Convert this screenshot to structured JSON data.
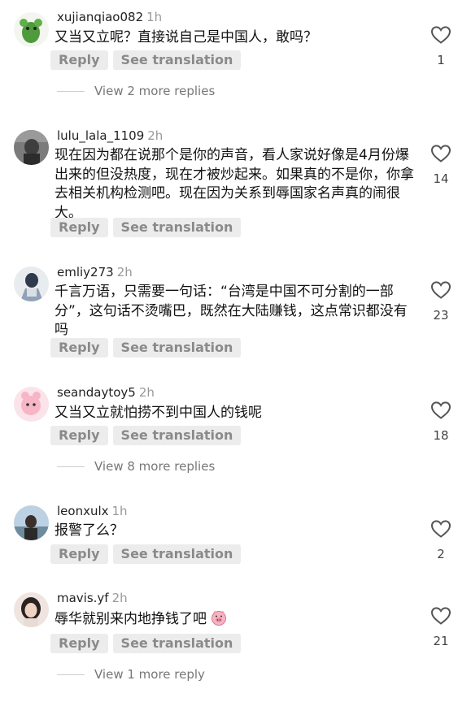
{
  "actions": {
    "reply_label": "Reply",
    "translate_label": "See translation"
  },
  "comments": [
    {
      "username": "xujianqiao082",
      "time": "1h",
      "text": "又当又立呢？直接说自己是中国人，敢吗？",
      "likes": "1"
    },
    {
      "username": "lulu_lala_1109",
      "time": "2h",
      "text": "现在因为都在说那个是你的声音，看人家说好像是4月份爆出来的但没热度，现在才被炒起来。如果真的不是你，你拿去相关机构检测吧。现在因为关系到辱国家名声真的闹很大。",
      "likes": "14"
    },
    {
      "username": "emliy273",
      "time": "2h",
      "text": "千言万语，只需要一句话：“台湾是中国不可分割的一部分”，这句话不烫嘴巴，既然在大陆赚钱，这点常识都没有吗",
      "likes": "23"
    },
    {
      "username": "seandaytoy5",
      "time": "2h",
      "text": "又当又立就怕捞不到中国人的钱呢",
      "likes": "18"
    },
    {
      "username": "leonxulx",
      "time": "1h",
      "text": "报警了么？",
      "likes": "2"
    },
    {
      "username": "mavis.yf",
      "time": "2h",
      "text": "辱华就别来内地挣钱了吧",
      "likes": "21"
    }
  ],
  "more_replies": [
    "View 2 more replies",
    "View 8 more replies",
    "View 1 more reply"
  ]
}
